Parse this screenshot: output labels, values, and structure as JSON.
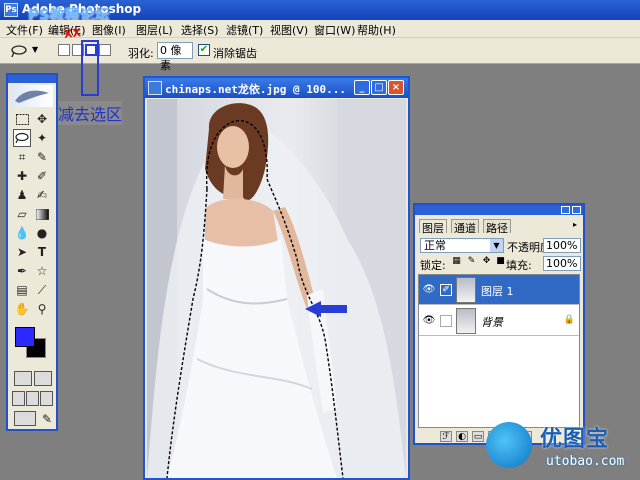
{
  "app": {
    "title": "Adobe Photoshop",
    "watermark_top": "PS教程论坛"
  },
  "menu": [
    "文件(F)",
    "编辑(E)",
    "图像(I)",
    "图层(L)",
    "选择(S)",
    "滤镜(T)",
    "视图(V)",
    "窗口(W)",
    "帮助(H)"
  ],
  "options": {
    "feather_label": "羽化:",
    "feather_value": "0 像素",
    "antialias_label": "消除锯齿",
    "antialias_checked": true,
    "selection_modes": [
      "new-selection",
      "add-to-selection",
      "subtract-from-selection",
      "intersect-selection"
    ],
    "active_mode": "subtract-from-selection",
    "red_mark": "XX"
  },
  "callout": {
    "text": "减去选区",
    "color": "#2433c8"
  },
  "document": {
    "title": "chinaps.net龙依.jpg @ 100...",
    "buttons": {
      "minimize": "_",
      "maximize": "□",
      "close": "×"
    }
  },
  "colors": {
    "foreground": "#2a2aff",
    "background": "#000000"
  },
  "layers_panel": {
    "tabs": [
      "图层",
      "通道",
      "路径"
    ],
    "blend_mode": "正常",
    "opacity_label": "不透明度:",
    "opacity_value": "100%",
    "lock_label": "锁定:",
    "fill_label": "填充:",
    "fill_value": "100%",
    "layers": [
      {
        "name": "图层 1",
        "selected": true,
        "locked": false
      },
      {
        "name": "背景",
        "selected": false,
        "locked": true
      }
    ]
  },
  "watermark": {
    "brand": "优图宝",
    "url": "utobao.com"
  }
}
